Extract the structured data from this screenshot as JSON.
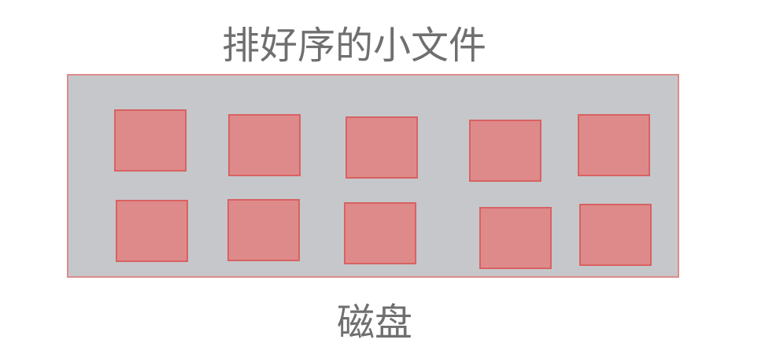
{
  "diagram": {
    "title": "排好序的小文件",
    "disk_label": "磁盘",
    "file_count": 10,
    "colors": {
      "disk_fill": "#c5c7cb",
      "disk_border": "#de8c8c",
      "file_fill": "#df8a8a",
      "file_border": "#d86262",
      "text": "#6f6f6f"
    }
  }
}
